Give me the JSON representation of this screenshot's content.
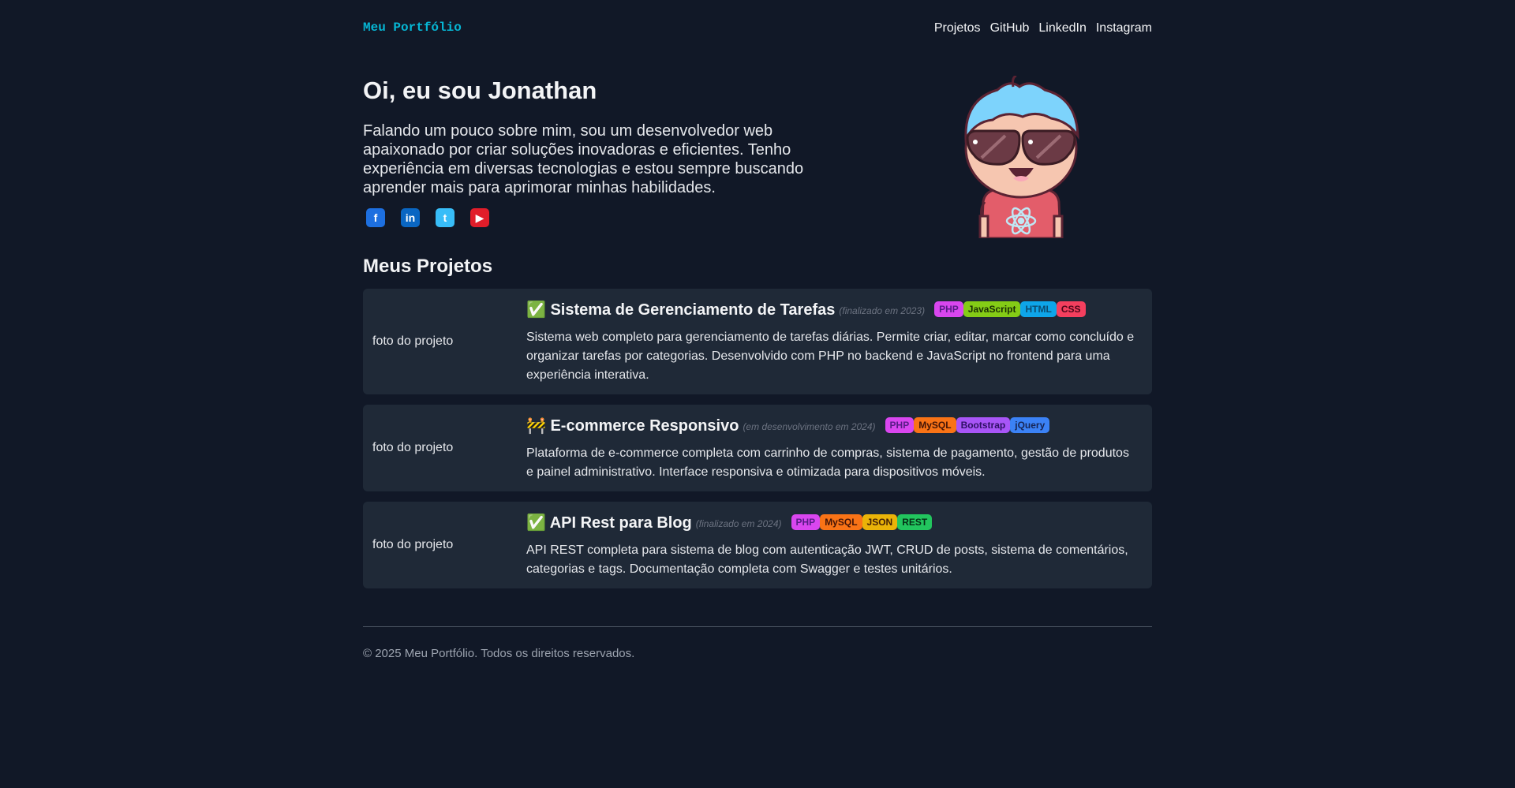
{
  "header": {
    "logo": "Meu Portfólio",
    "nav": [
      "Projetos",
      "GitHub",
      "LinkedIn",
      "Instagram"
    ]
  },
  "hero": {
    "title": "Oi, eu sou Jonathan",
    "bio": "Falando um pouco sobre mim, sou um desenvolvedor web apaixonado por criar soluções inovadoras e eficientes. Tenho experiência em diversas tecnologias e estou sempre buscando aprender mais para aprimorar minhas habilidades.",
    "socials": [
      {
        "icon": "facebook-icon",
        "glyph": "f",
        "color": "#1d6fe0"
      },
      {
        "icon": "linkedin-icon",
        "glyph": "in",
        "color": "#0a66c2"
      },
      {
        "icon": "twitter-icon",
        "glyph": "t",
        "color": "#38bdf8"
      },
      {
        "icon": "youtube-icon",
        "glyph": "▶",
        "color": "#e11d2a"
      }
    ]
  },
  "projects_section": {
    "title": "Meus Projetos",
    "items": [
      {
        "photo": "foto do projeto",
        "title": "✅ Sistema de Gerenciamento de Tarefas",
        "status": "(finalizado em 2023)",
        "tags": [
          {
            "label": "PHP",
            "bg": "#d946ef",
            "fg": "#581c87"
          },
          {
            "label": "JavaScript",
            "bg": "#84cc16",
            "fg": "#1a2e05"
          },
          {
            "label": "HTML",
            "bg": "#0ea5e9",
            "fg": "#0c4a6e"
          },
          {
            "label": "CSS",
            "bg": "#f43f5e",
            "fg": "#4c0519"
          }
        ],
        "description": "Sistema web completo para gerenciamento de tarefas diárias. Permite criar, editar, marcar como concluído e organizar tarefas por categorias. Desenvolvido com PHP no backend e JavaScript no frontend para uma experiência interativa."
      },
      {
        "photo": "foto do projeto",
        "title": "🚧 E-commerce Responsivo",
        "status": "(em desenvolvimento em 2024)",
        "tags": [
          {
            "label": "PHP",
            "bg": "#d946ef",
            "fg": "#581c87"
          },
          {
            "label": "MySQL",
            "bg": "#f97316",
            "fg": "#431407"
          },
          {
            "label": "Bootstrap",
            "bg": "#a855f7",
            "fg": "#2e1065"
          },
          {
            "label": "jQuery",
            "bg": "#3b82f6",
            "fg": "#172554"
          }
        ],
        "description": "Plataforma de e-commerce completa com carrinho de compras, sistema de pagamento, gestão de produtos e painel administrativo. Interface responsiva e otimizada para dispositivos móveis."
      },
      {
        "photo": "foto do projeto",
        "title": "✅ API Rest para Blog",
        "status": "(finalizado em 2024)",
        "tags": [
          {
            "label": "PHP",
            "bg": "#d946ef",
            "fg": "#581c87"
          },
          {
            "label": "MySQL",
            "bg": "#f97316",
            "fg": "#431407"
          },
          {
            "label": "JSON",
            "bg": "#eab308",
            "fg": "#422006"
          },
          {
            "label": "REST",
            "bg": "#22c55e",
            "fg": "#052e16"
          }
        ],
        "description": "API REST completa para sistema de blog com autenticação JWT, CRUD de posts, sistema de comentários, categorias e tags. Documentação completa com Swagger e testes unitários."
      }
    ]
  },
  "footer": {
    "text": "© 2025 Meu Portfólio. Todos os direitos reservados."
  }
}
